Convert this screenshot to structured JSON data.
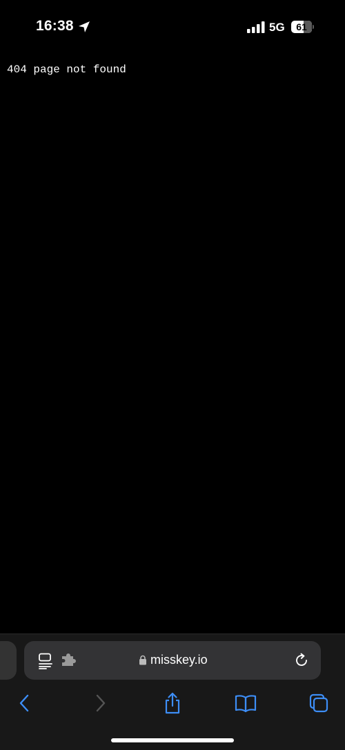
{
  "status_bar": {
    "time": "16:38",
    "network": "5G",
    "battery_level": "61",
    "battery_fraction": 0.61
  },
  "page": {
    "message": "404 page not found"
  },
  "browser": {
    "url": "misskey.io",
    "icons": {
      "reader": "reader-mode-icon",
      "extension": "extension-icon",
      "lock": "lock-icon",
      "reload": "reload-icon"
    },
    "toolbar": [
      {
        "name": "back-button",
        "icon": "chevron-left-icon",
        "enabled": true
      },
      {
        "name": "forward-button",
        "icon": "chevron-right-icon",
        "enabled": false
      },
      {
        "name": "share-button",
        "icon": "share-icon",
        "enabled": true
      },
      {
        "name": "bookmarks-button",
        "icon": "book-icon",
        "enabled": true
      },
      {
        "name": "tabs-button",
        "icon": "tabs-icon",
        "enabled": true
      }
    ],
    "colors": {
      "accent": "#3d8ef7",
      "disabled": "#555555",
      "address_bg": "#333335",
      "chrome_bg": "#181818"
    }
  }
}
